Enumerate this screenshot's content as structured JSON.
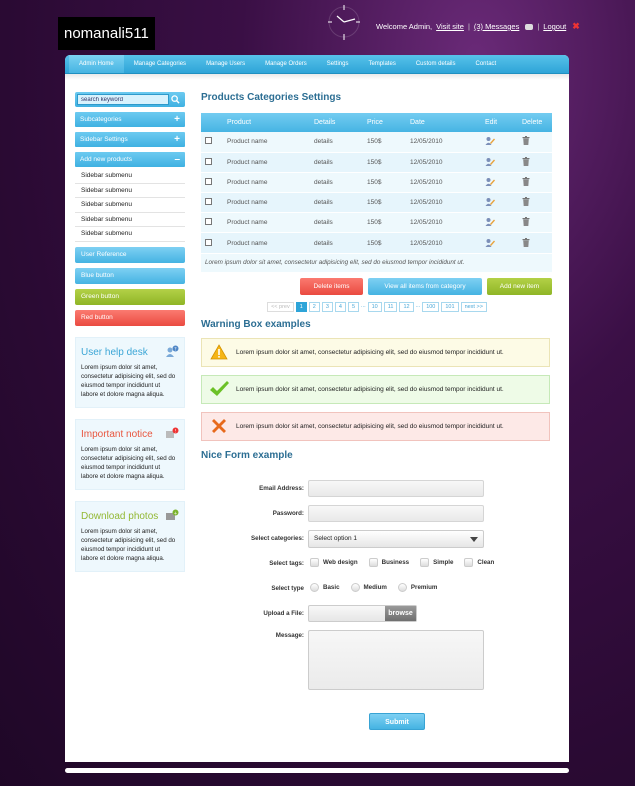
{
  "header": {
    "logo_text": "nomanali511",
    "welcome": "Welcome Admin,",
    "visit_site": "Visit site",
    "messages": "(3) Messages",
    "logout": "Logout",
    "separator": "|"
  },
  "nav": {
    "items": [
      {
        "label": "Admin Home",
        "active": true
      },
      {
        "label": "Manage Categories"
      },
      {
        "label": "Manage Users"
      },
      {
        "label": "Manage Orders"
      },
      {
        "label": "Settings"
      },
      {
        "label": "Templates"
      },
      {
        "label": "Custom details"
      },
      {
        "label": "Contact"
      }
    ]
  },
  "sidebar": {
    "search_value": "search keyword",
    "sections": [
      {
        "label": "Subcategories",
        "toggle": "+"
      },
      {
        "label": "Sidebar Settings",
        "toggle": "+"
      },
      {
        "label": "Add new products",
        "toggle": "–"
      }
    ],
    "submenu": [
      "Sidebar submenu",
      "Sidebar submenu",
      "Sidebar submenu",
      "Sidebar submenu",
      "Sidebar submenu"
    ],
    "buttons": {
      "user_reference": "User Reference",
      "blue": "Blue button",
      "green": "Green button",
      "red": "Red button"
    },
    "boxes": [
      {
        "title": "User help desk",
        "color": "#3ba6d6",
        "text": "Lorem ipsum dolor sit amet, consectetur adipisicing elit, sed do eiusmod tempor incididunt ut labore et dolore magna aliqua."
      },
      {
        "title": "Important notice",
        "color": "#e8553e",
        "text": "Lorem ipsum dolor sit amet, consectetur adipisicing elit, sed do eiusmod tempor incididunt ut labore et dolore magna aliqua."
      },
      {
        "title": "Download photos",
        "color": "#93b834",
        "text": "Lorem ipsum dolor sit amet, consectetur adipisicing elit, sed do eiusmod tempor incididunt ut labore et dolore magna aliqua."
      }
    ]
  },
  "main": {
    "title": "Products Categories Settings",
    "table": {
      "headers": [
        "",
        "Product",
        "Details",
        "Price",
        "Date",
        "Edit",
        "Delete"
      ],
      "rows": [
        {
          "product": "Product name",
          "details": "details",
          "price": "150$",
          "date": "12/05/2010"
        },
        {
          "product": "Product name",
          "details": "details",
          "price": "150$",
          "date": "12/05/2010"
        },
        {
          "product": "Product name",
          "details": "details",
          "price": "150$",
          "date": "12/05/2010"
        },
        {
          "product": "Product name",
          "details": "details",
          "price": "150$",
          "date": "12/05/2010"
        },
        {
          "product": "Product name",
          "details": "details",
          "price": "150$",
          "date": "12/05/2010"
        },
        {
          "product": "Product name",
          "details": "details",
          "price": "150$",
          "date": "12/05/2010"
        }
      ],
      "footer": "Lorem ipsum dolor sit amet, consectetur adipisicing elit, sed do eiusmod tempor incididunt ut."
    },
    "actions": {
      "delete": "Delete items",
      "view_all": "View all items from category",
      "add": "Add new item"
    },
    "pager": {
      "prev": "<< prev",
      "pages": [
        "1",
        "2",
        "3",
        "4",
        "5",
        "...",
        "10",
        "11",
        "12",
        "...",
        "100",
        "101"
      ],
      "current": "1",
      "next": "next >>"
    },
    "warnings_title": "Warning Box examples",
    "warnings": [
      {
        "type": "yellow",
        "text": "Lorem ipsum dolor sit amet, consectetur adipisicing elit, sed do eiusmod tempor incididunt ut."
      },
      {
        "type": "green",
        "text": "Lorem ipsum dolor sit amet, consectetur adipisicing elit, sed do eiusmod tempor incididunt ut."
      },
      {
        "type": "red",
        "text": "Lorem ipsum dolor sit amet, consectetur adipisicing elit, sed do eiusmod tempor incididunt ut."
      }
    ],
    "form_title": "Nice Form example",
    "form": {
      "email_label": "Email Address:",
      "password_label": "Password:",
      "categories_label": "Select categories:",
      "categories_value": "Select option 1",
      "tags_label": "Select tags:",
      "tags": [
        "Web design",
        "Business",
        "Simple",
        "Clean"
      ],
      "type_label": "Select type",
      "types": [
        "Basic",
        "Medium",
        "Premium"
      ],
      "file_label": "Upload a File:",
      "browse": "browse",
      "message_label": "Message:",
      "submit": "Submit"
    }
  }
}
